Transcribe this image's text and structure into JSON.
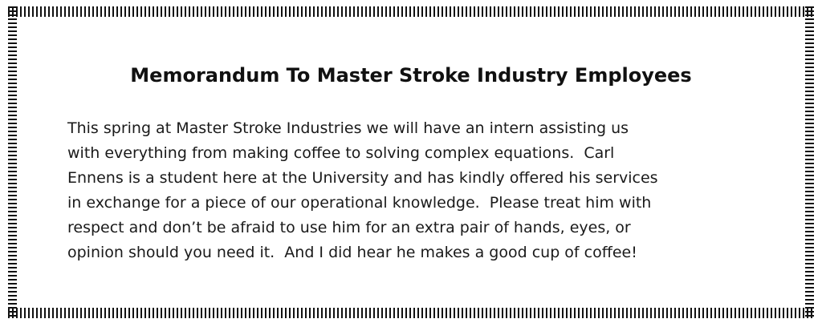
{
  "memo": {
    "title": "Memorandum To Master Stroke Industry Employees",
    "lines": [
      "This spring at Master Stroke Industries we will have an intern assisting us",
      "with everything from making coffee to solving complex equations.  Carl",
      "Ennens is a student here at the University and has kindly offered his services",
      "in exchange for a piece of our operational knowledge.  Please treat him with",
      "respect and don’t be afraid to use him for an extra pair of hands, eyes, or",
      "opinion should you need it.  And I did hear he makes a good cup of coffee!"
    ]
  }
}
